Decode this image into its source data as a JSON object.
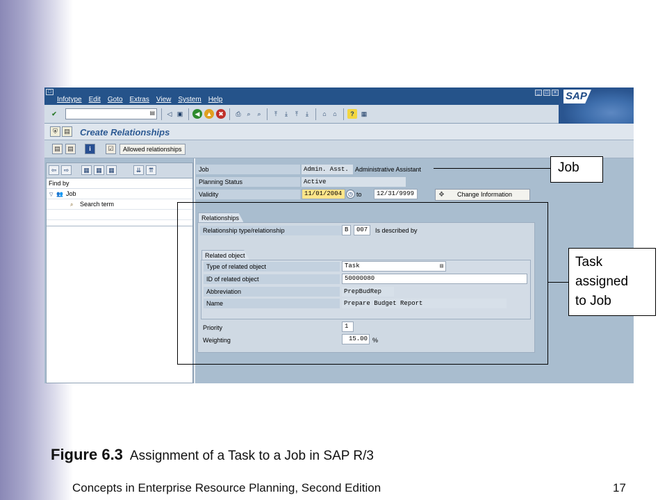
{
  "menubar": {
    "system_icon": "□",
    "items": [
      "Infotype",
      "Edit",
      "Goto",
      "Extras",
      "View",
      "System",
      "Help"
    ],
    "window_controls": [
      "_",
      "□",
      "×"
    ],
    "logo_text": "SAP"
  },
  "toolbar": {
    "enter_icon": "✔",
    "command_dropdown": "▤",
    "icons": [
      "◁",
      "▣",
      "◀",
      "▲",
      "✖",
      "⎙",
      "⌕",
      "⌕",
      "⤒",
      "⤓",
      "⤒",
      "⤓",
      "⌂",
      "⌂",
      "?",
      "▦"
    ]
  },
  "title": {
    "icons": [
      "⛨",
      "▤"
    ],
    "text": "Create Relationships"
  },
  "app_toolbar": {
    "icons": [
      "▤",
      "▤",
      "i",
      "☑"
    ],
    "allowed_relationships": "Allowed relationships"
  },
  "left_panel": {
    "toolbar_icons": [
      "⇦",
      "⇨",
      "▦",
      "▦",
      "▦",
      "⇊",
      "⇈"
    ],
    "find_by": "Find by",
    "tree": [
      {
        "toggle": "▽",
        "icon": "👥",
        "label": "Job"
      },
      {
        "toggle": "",
        "icon": "⌕",
        "label": "Search term"
      }
    ]
  },
  "header_fields": {
    "job_label": "Job",
    "job_abbr": "Admin. Asst.",
    "job_name": "Administrative Assistant",
    "planning_status_label": "Planning Status",
    "planning_status_value": "Active",
    "validity_label": "Validity",
    "validity_from": "11/01/2004",
    "validity_to_label": "to",
    "validity_to": "12/31/9999",
    "change_info_icon": "❖",
    "change_info_label": "Change Information"
  },
  "relationships": {
    "tab_label": "Relationships",
    "type_label": "Relationship type/relationship",
    "type_code": "B",
    "rel_code": "007",
    "rel_text": "Is described by"
  },
  "related_object": {
    "tab_label": "Related object",
    "type_label": "Type of related object",
    "type_value": "Task",
    "type_dropdown": "▤",
    "id_label": "ID of related object",
    "id_value": "50000080",
    "abbr_label": "Abbreviation",
    "abbr_value": "PrepBudRep",
    "name_label": "Name",
    "name_value": "Prepare Budget Report"
  },
  "bottom_fields": {
    "priority_label": "Priority",
    "priority_value": "1",
    "weighting_label": "Weighting",
    "weighting_value": "15.00",
    "weighting_unit": "%"
  },
  "callouts": {
    "job": "Job",
    "task_line1": "Task",
    "task_line2": "assigned",
    "task_line3": "to Job"
  },
  "caption": {
    "figure": "Figure 6.3",
    "text": "Assignment of a Task to a Job in SAP R/3"
  },
  "footer": {
    "book": "Concepts in Enterprise Resource Planning, Second Edition",
    "page": "17"
  },
  "colors": {
    "menubar": "#25538a",
    "window_bg": "#a9bdcf",
    "title": "#2d5a93",
    "highlight_input": "#ffe58a"
  }
}
